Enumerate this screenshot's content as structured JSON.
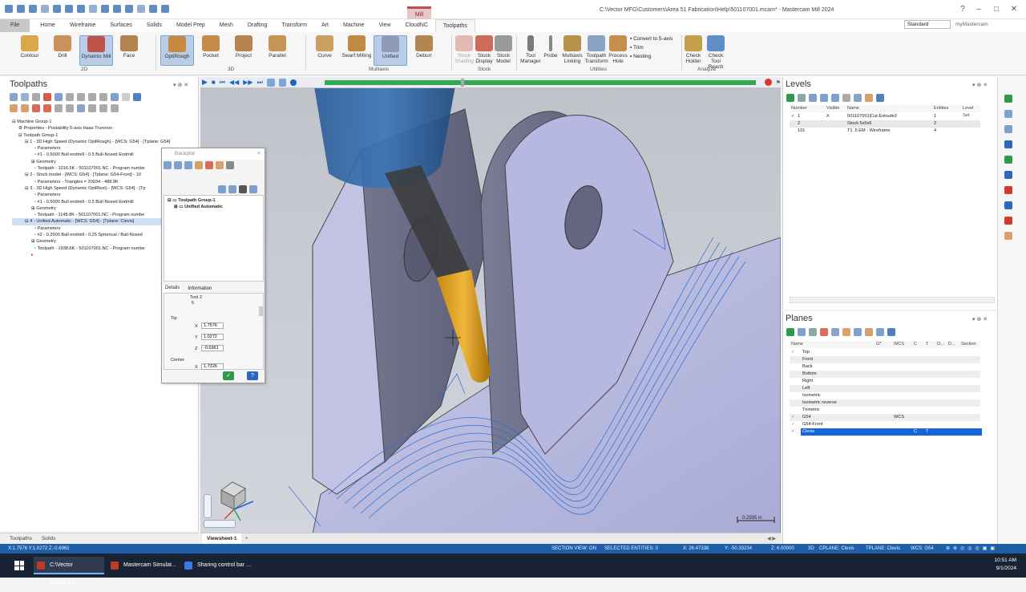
{
  "window": {
    "title": "C:\\Vector MFG\\Customers\\Area 51 Fabrication\\Help\\501107001.mcam* - Mastercam Mill 2024",
    "context_tab_label": "Mill"
  },
  "ribbon_tabs": [
    "File",
    "Home",
    "Wireframe",
    "Surfaces",
    "Solids",
    "Model Prep",
    "Mesh",
    "Drafting",
    "Transform",
    "Art",
    "Machine",
    "View",
    "CloudNC",
    "Toolpaths"
  ],
  "workspace": {
    "selected": "Standard",
    "user_label": "myMastercam"
  },
  "ribbon": {
    "twod": [
      "Contour",
      "Drill",
      "Dynamic Mill",
      "Face"
    ],
    "threed": [
      "OptiRough",
      "Pocket",
      "Project",
      "Parallel"
    ],
    "multiaxis": [
      "Curve",
      "Swarf Milling",
      "Unified",
      "Deburr"
    ],
    "stock": [
      "Stock Shading",
      "Stock Display",
      "Stock Model"
    ],
    "utilities_big": [
      "Tool Manager",
      "Probe",
      "Multiaxis Linking",
      "Toolpath Transform",
      "Process Hole"
    ],
    "utilities_small": [
      "Convert to 5-axis",
      "Trim",
      "Nesting"
    ],
    "analyze": [
      "Check Holder",
      "Check Tool Reach"
    ],
    "groups": [
      "2D",
      "3D",
      "Multiaxis",
      "Stock",
      "Utilities",
      "Analyze"
    ]
  },
  "toolpaths_panel": {
    "title": "Toolpaths",
    "tree": [
      "Machine Group-1",
      "Properties - Postability 5-axis Haas Trunnion",
      "Toolpath Group-1",
      "1 - 3D High Speed (Dynamic OptiRough) - [WCS: G54] - [Tplane: G54]",
      "Parameters",
      "#1 - 0.5000 Bull endmill - 0.5 Bull-Nosed Endmill",
      "Geometry",
      "Toolpath - 1016.5K - 501107001.NC - Program numbe",
      "2 - Stock model - [WCS: G54] - [Tplane: G54-Front] - 10",
      "Parameters - Triangles = 20034 - 488.9K",
      "3 - 3D High Speed (Dynamic OptiRest) - [WCS: G54] - [Tp",
      "Parameters",
      "#1 - 0.5000 Bull endmill - 0.5 Bull-Nosed Endmill",
      "Geometry",
      "Toolpath - 1148.8K - 501107001.NC - Program numbe",
      "4 - Unified Automatic - [WCS: G54] - [Tplane: Clevis]",
      "Parameters",
      "#2 - 0.2500 Ball endmill - 0.25 Spherical / Ball-Nosed",
      "Geometry",
      "Toolpath - 1938.6K - 501107001.NC - Program numbe"
    ],
    "bottom_tabs": [
      "Toolpaths",
      "Solids"
    ]
  },
  "backplot": {
    "title": "Backplot",
    "tree": [
      "Toolpath Group-1",
      "Unified Automatic"
    ],
    "tabs": [
      "Details",
      "Information"
    ],
    "tool_label": "Tool 2",
    "tool_value": "5",
    "tip_label": "Tip",
    "tip": {
      "X": "1.7576",
      "Y": "1.0272",
      "Z": "-0.6961"
    },
    "center_label": "Center",
    "center": {
      "X": "1.7326"
    }
  },
  "viewport": {
    "sheet_tab": "Viewsheet-1",
    "scale": "0.2935 in"
  },
  "levels": {
    "title": "Levels",
    "columns": [
      "Number",
      "Visible",
      "Name",
      "Entities",
      "Level Set"
    ],
    "rows": [
      {
        "number": "1",
        "visible": "X",
        "name": "501107001|Cut-Extrude2",
        "entities": "1",
        "active": "✓"
      },
      {
        "number": "2",
        "visible": "",
        "name": "Stock 5x5x6",
        "entities": "2",
        "active": ""
      },
      {
        "number": "101",
        "visible": "",
        "name": "T1 .5 EM - Wireframe",
        "entities": "4",
        "active": ""
      }
    ]
  },
  "planes": {
    "title": "Planes",
    "columns": [
      "Name",
      "G*",
      "WCS",
      "C",
      "T",
      "O...",
      "D...",
      "Section"
    ],
    "rows": [
      "Top",
      "Front",
      "Back",
      "Bottom",
      "Right",
      "Left",
      "Isometric",
      "Isometric reverse",
      "Trimetric",
      "G54",
      "G54-Front",
      "Clevis"
    ],
    "g54_wcs": "WCS",
    "clevis_c": "C",
    "clevis_t": "T"
  },
  "status_bar": {
    "coords": "X:1.7576   Y:1.0272   Z:-0.6961",
    "section_view": "SECTION VIEW: ON",
    "selected": "SELECTED ENTITIES: 0",
    "x": "X:   26.47338",
    "y": "Y:   -50.33234",
    "z": "Z:   6.00000",
    "mode": "3D",
    "cplane": "CPLANE: Clevis",
    "tplane": "TPLANE: Clevis",
    "wcs": "WCS: G54"
  },
  "taskbar": {
    "items": [
      "C:\\Vector MFG\\Cust...",
      "Mastercam Simulat...",
      "Sharing control bar ..."
    ],
    "time": "10:51 AM",
    "date": "9/1/2024"
  },
  "colors": {
    "accent": "#1f5fa8",
    "selection": "#1565d8",
    "toolpath": "#2a6fd6"
  }
}
